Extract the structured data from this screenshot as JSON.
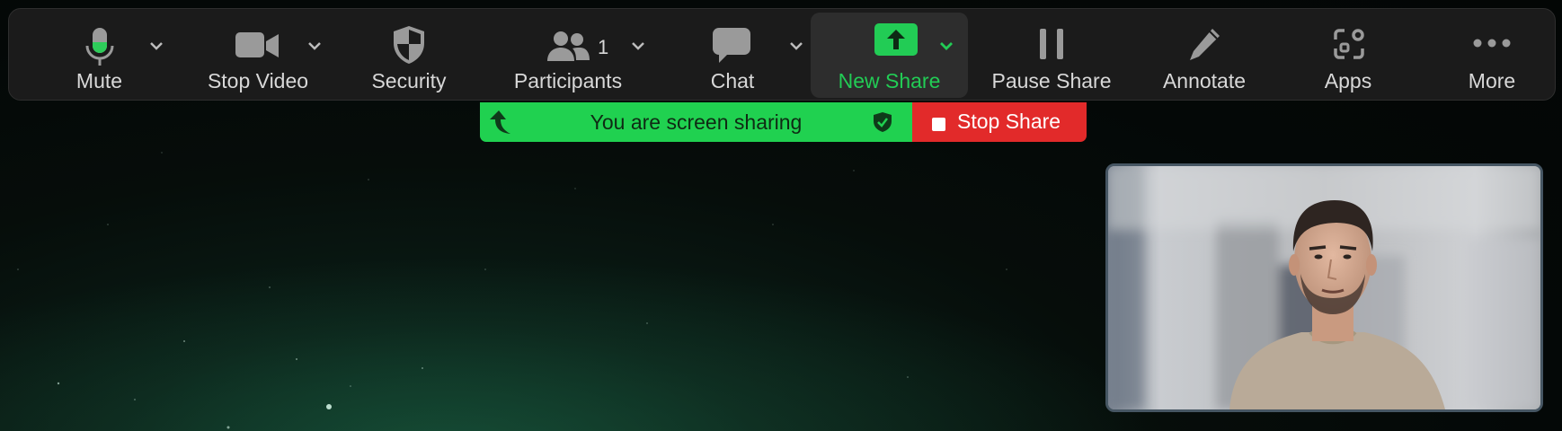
{
  "toolbar": {
    "mute_label": "Mute",
    "stop_video_label": "Stop Video",
    "security_label": "Security",
    "participants_label": "Participants",
    "participants_count": "1",
    "chat_label": "Chat",
    "new_share_label": "New Share",
    "pause_share_label": "Pause Share",
    "annotate_label": "Annotate",
    "apps_label": "Apps",
    "more_label": "More"
  },
  "banner": {
    "sharing_text": "You are screen sharing",
    "stop_share_label": "Stop Share"
  },
  "colors": {
    "share_green": "#20d150",
    "stop_red": "#e22a2a",
    "toolbar_bg": "#1b1b1b",
    "active_label": "#22cc55"
  },
  "icons": [
    "microphone-icon",
    "video-camera-icon",
    "shield-icon",
    "participants-icon",
    "chat-bubble-icon",
    "share-up-arrow-icon",
    "pause-icon",
    "pencil-icon",
    "apps-icon",
    "more-dots-icon",
    "caret-down-icon"
  ]
}
